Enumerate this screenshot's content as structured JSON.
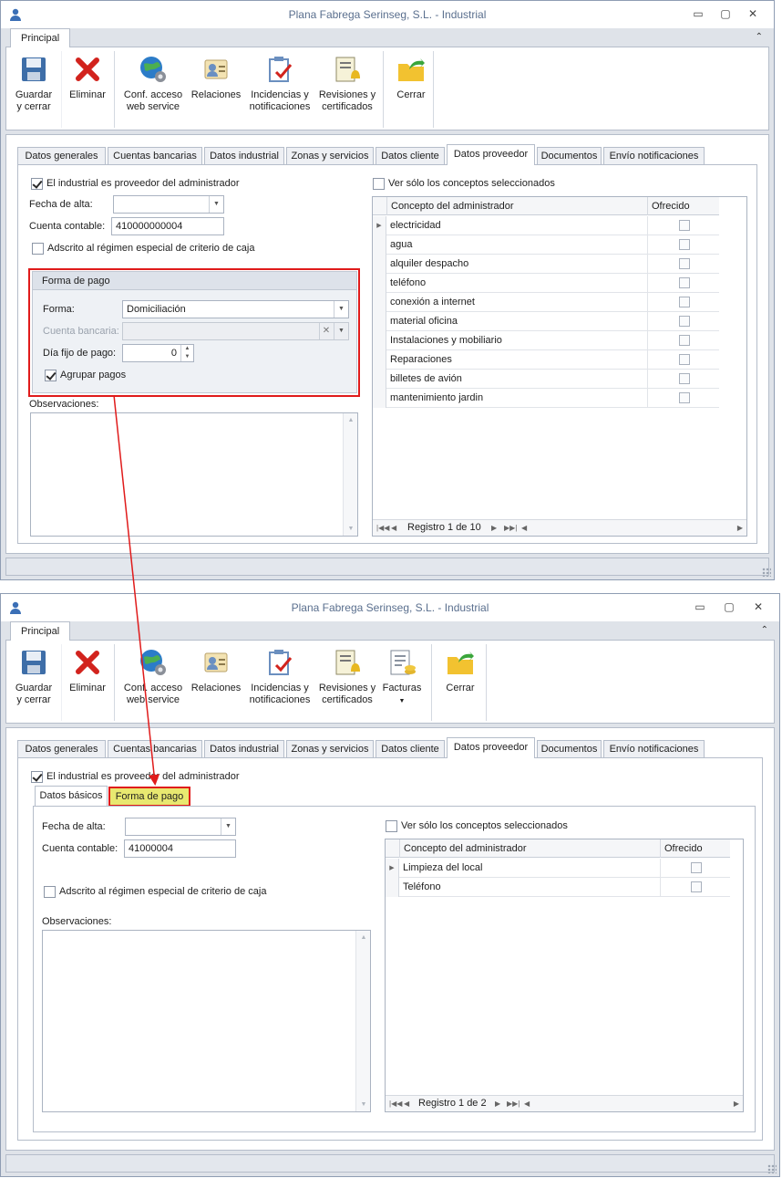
{
  "window_title": "Plana Fabrega Serinseg, S.L. - Industrial",
  "window_buttons": {
    "minimize": "▭",
    "restore": "▢",
    "close": "✕"
  },
  "ribbon": {
    "tab_label": "Principal",
    "buttons": {
      "save": "Guardar y cerrar",
      "delete": "Eliminar",
      "webservice": "Conf. acceso web service",
      "relations": "Relaciones",
      "incidents": "Incidencias y notificaciones",
      "reviews": "Revisiones y certificados",
      "invoices": "Facturas",
      "close": "Cerrar"
    }
  },
  "tabs": [
    "Datos generales",
    "Cuentas bancarias",
    "Datos industrial",
    "Zonas y servicios",
    "Datos cliente",
    "Datos proveedor",
    "Documentos",
    "Envío notificaciones"
  ],
  "active_tab": "Datos proveedor",
  "window1": {
    "is_provider_label": "El industrial es proveedor del administrador",
    "is_provider_checked": true,
    "fecha_alta_label": "Fecha de alta:",
    "fecha_alta_value": "",
    "cuenta_contable_label": "Cuenta contable:",
    "cuenta_contable_value": "410000000004",
    "criterio_caja_label": "Adscrito al régimen especial de criterio de caja",
    "criterio_caja_checked": false,
    "forma_pago_group": {
      "header": "Forma de pago",
      "forma_label": "Forma:",
      "forma_value": "Domiciliación",
      "cuenta_bancaria_label": "Cuenta bancaria:",
      "cuenta_bancaria_value": "",
      "dia_fijo_label": "Día fijo de pago:",
      "dia_fijo_value": "0",
      "agrupar_label": "Agrupar pagos",
      "agrupar_checked": true
    },
    "observaciones_label": "Observaciones:",
    "ver_solo_label": "Ver sólo los conceptos seleccionados",
    "grid": {
      "columns": [
        "Concepto del administrador",
        "Ofrecido"
      ],
      "rows": [
        "electricidad",
        "agua",
        "alquiler despacho",
        "teléfono",
        "conexión a internet",
        "material oficina",
        "Instalaciones y mobiliario",
        "Reparaciones",
        "billetes de avión",
        "mantenimiento jardin"
      ],
      "nav_text": "Registro 1 de 10"
    }
  },
  "window2": {
    "is_provider_label": "El industrial es proveedor del administrador",
    "is_provider_checked": true,
    "subtabs": [
      "Datos básicos",
      "Forma de pago"
    ],
    "fecha_alta_label": "Fecha de alta:",
    "fecha_alta_value": "",
    "cuenta_contable_label": "Cuenta contable:",
    "cuenta_contable_value": "41000004",
    "criterio_caja_label": "Adscrito al régimen especial de criterio de caja",
    "criterio_caja_checked": false,
    "observaciones_label": "Observaciones:",
    "ver_solo_label": "Ver sólo los conceptos seleccionados",
    "grid": {
      "columns": [
        "Concepto del administrador",
        "Ofrecido"
      ],
      "rows": [
        "Limpieza del local",
        "Teléfono"
      ],
      "nav_text": "Registro 1 de 2"
    }
  },
  "colors": {
    "highlight": "#e01b1b",
    "highlight_fill": "#e8e870",
    "title_text": "#5a6f8e"
  }
}
